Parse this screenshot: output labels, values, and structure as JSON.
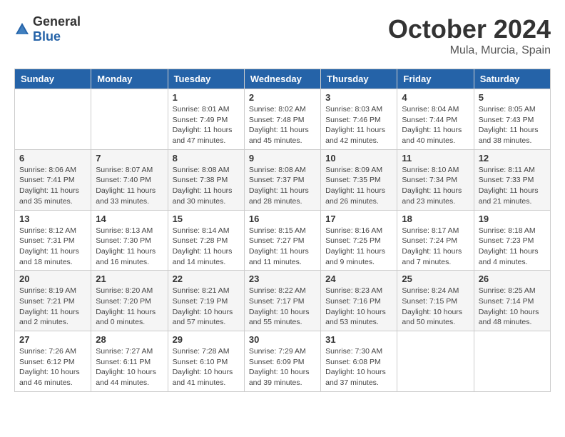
{
  "logo": {
    "general": "General",
    "blue": "Blue"
  },
  "header": {
    "month": "October 2024",
    "location": "Mula, Murcia, Spain"
  },
  "weekdays": [
    "Sunday",
    "Monday",
    "Tuesday",
    "Wednesday",
    "Thursday",
    "Friday",
    "Saturday"
  ],
  "weeks": [
    [
      {
        "day": "",
        "info": ""
      },
      {
        "day": "",
        "info": ""
      },
      {
        "day": "1",
        "info": "Sunrise: 8:01 AM\nSunset: 7:49 PM\nDaylight: 11 hours and 47 minutes."
      },
      {
        "day": "2",
        "info": "Sunrise: 8:02 AM\nSunset: 7:48 PM\nDaylight: 11 hours and 45 minutes."
      },
      {
        "day": "3",
        "info": "Sunrise: 8:03 AM\nSunset: 7:46 PM\nDaylight: 11 hours and 42 minutes."
      },
      {
        "day": "4",
        "info": "Sunrise: 8:04 AM\nSunset: 7:44 PM\nDaylight: 11 hours and 40 minutes."
      },
      {
        "day": "5",
        "info": "Sunrise: 8:05 AM\nSunset: 7:43 PM\nDaylight: 11 hours and 38 minutes."
      }
    ],
    [
      {
        "day": "6",
        "info": "Sunrise: 8:06 AM\nSunset: 7:41 PM\nDaylight: 11 hours and 35 minutes."
      },
      {
        "day": "7",
        "info": "Sunrise: 8:07 AM\nSunset: 7:40 PM\nDaylight: 11 hours and 33 minutes."
      },
      {
        "day": "8",
        "info": "Sunrise: 8:08 AM\nSunset: 7:38 PM\nDaylight: 11 hours and 30 minutes."
      },
      {
        "day": "9",
        "info": "Sunrise: 8:08 AM\nSunset: 7:37 PM\nDaylight: 11 hours and 28 minutes."
      },
      {
        "day": "10",
        "info": "Sunrise: 8:09 AM\nSunset: 7:35 PM\nDaylight: 11 hours and 26 minutes."
      },
      {
        "day": "11",
        "info": "Sunrise: 8:10 AM\nSunset: 7:34 PM\nDaylight: 11 hours and 23 minutes."
      },
      {
        "day": "12",
        "info": "Sunrise: 8:11 AM\nSunset: 7:33 PM\nDaylight: 11 hours and 21 minutes."
      }
    ],
    [
      {
        "day": "13",
        "info": "Sunrise: 8:12 AM\nSunset: 7:31 PM\nDaylight: 11 hours and 18 minutes."
      },
      {
        "day": "14",
        "info": "Sunrise: 8:13 AM\nSunset: 7:30 PM\nDaylight: 11 hours and 16 minutes."
      },
      {
        "day": "15",
        "info": "Sunrise: 8:14 AM\nSunset: 7:28 PM\nDaylight: 11 hours and 14 minutes."
      },
      {
        "day": "16",
        "info": "Sunrise: 8:15 AM\nSunset: 7:27 PM\nDaylight: 11 hours and 11 minutes."
      },
      {
        "day": "17",
        "info": "Sunrise: 8:16 AM\nSunset: 7:25 PM\nDaylight: 11 hours and 9 minutes."
      },
      {
        "day": "18",
        "info": "Sunrise: 8:17 AM\nSunset: 7:24 PM\nDaylight: 11 hours and 7 minutes."
      },
      {
        "day": "19",
        "info": "Sunrise: 8:18 AM\nSunset: 7:23 PM\nDaylight: 11 hours and 4 minutes."
      }
    ],
    [
      {
        "day": "20",
        "info": "Sunrise: 8:19 AM\nSunset: 7:21 PM\nDaylight: 11 hours and 2 minutes."
      },
      {
        "day": "21",
        "info": "Sunrise: 8:20 AM\nSunset: 7:20 PM\nDaylight: 11 hours and 0 minutes."
      },
      {
        "day": "22",
        "info": "Sunrise: 8:21 AM\nSunset: 7:19 PM\nDaylight: 10 hours and 57 minutes."
      },
      {
        "day": "23",
        "info": "Sunrise: 8:22 AM\nSunset: 7:17 PM\nDaylight: 10 hours and 55 minutes."
      },
      {
        "day": "24",
        "info": "Sunrise: 8:23 AM\nSunset: 7:16 PM\nDaylight: 10 hours and 53 minutes."
      },
      {
        "day": "25",
        "info": "Sunrise: 8:24 AM\nSunset: 7:15 PM\nDaylight: 10 hours and 50 minutes."
      },
      {
        "day": "26",
        "info": "Sunrise: 8:25 AM\nSunset: 7:14 PM\nDaylight: 10 hours and 48 minutes."
      }
    ],
    [
      {
        "day": "27",
        "info": "Sunrise: 7:26 AM\nSunset: 6:12 PM\nDaylight: 10 hours and 46 minutes."
      },
      {
        "day": "28",
        "info": "Sunrise: 7:27 AM\nSunset: 6:11 PM\nDaylight: 10 hours and 44 minutes."
      },
      {
        "day": "29",
        "info": "Sunrise: 7:28 AM\nSunset: 6:10 PM\nDaylight: 10 hours and 41 minutes."
      },
      {
        "day": "30",
        "info": "Sunrise: 7:29 AM\nSunset: 6:09 PM\nDaylight: 10 hours and 39 minutes."
      },
      {
        "day": "31",
        "info": "Sunrise: 7:30 AM\nSunset: 6:08 PM\nDaylight: 10 hours and 37 minutes."
      },
      {
        "day": "",
        "info": ""
      },
      {
        "day": "",
        "info": ""
      }
    ]
  ]
}
